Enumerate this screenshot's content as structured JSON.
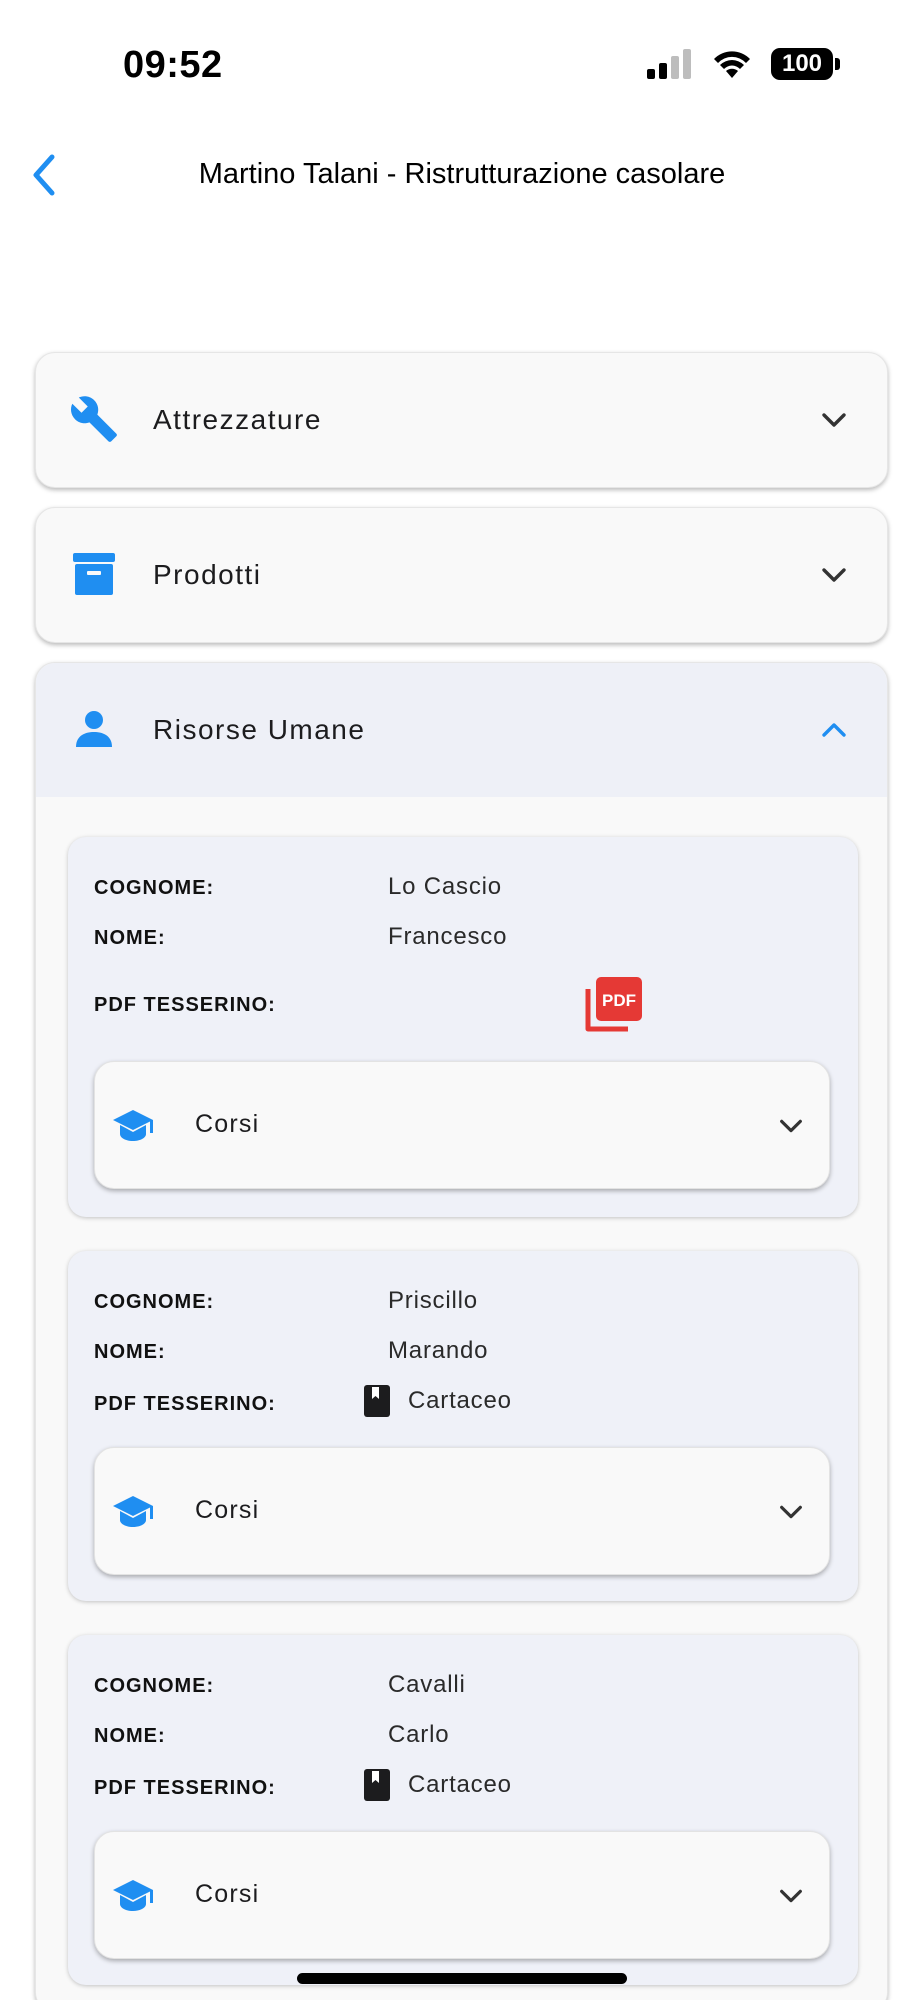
{
  "status_bar": {
    "time": "09:52",
    "battery_level": "100",
    "cellular_bars_filled": 2,
    "cellular_bars_total": 4
  },
  "nav": {
    "title": "Martino Talani - Ristrutturazione casolare",
    "back_icon": "chevron-left-icon"
  },
  "colors": {
    "accent": "#1f8ef1",
    "pdf_red": "#e53935",
    "text": "#1c1c1e"
  },
  "sections": [
    {
      "label": "Attrezzature",
      "icon": "wrench-icon",
      "expanded": false
    },
    {
      "label": "Prodotti",
      "icon": "archive-box-icon",
      "expanded": false
    },
    {
      "label": "Risorse Umane",
      "icon": "person-icon",
      "expanded": true
    }
  ],
  "labels": {
    "cognome": "COGNOME:",
    "nome": "NOME:",
    "pdf_tesserino": "PDF TESSERINO:",
    "corsi": "Corsi",
    "pdf_glyph": "PDF"
  },
  "people": [
    {
      "cognome": "Lo Cascio",
      "nome": "Francesco",
      "tesserino_type": "pdf",
      "tesserino": ""
    },
    {
      "cognome": "Priscillo",
      "nome": "Marando",
      "tesserino_type": "paper",
      "tesserino": "Cartaceo"
    },
    {
      "cognome": "Cavalli",
      "nome": "Carlo",
      "tesserino_type": "paper",
      "tesserino": "Cartaceo"
    }
  ]
}
